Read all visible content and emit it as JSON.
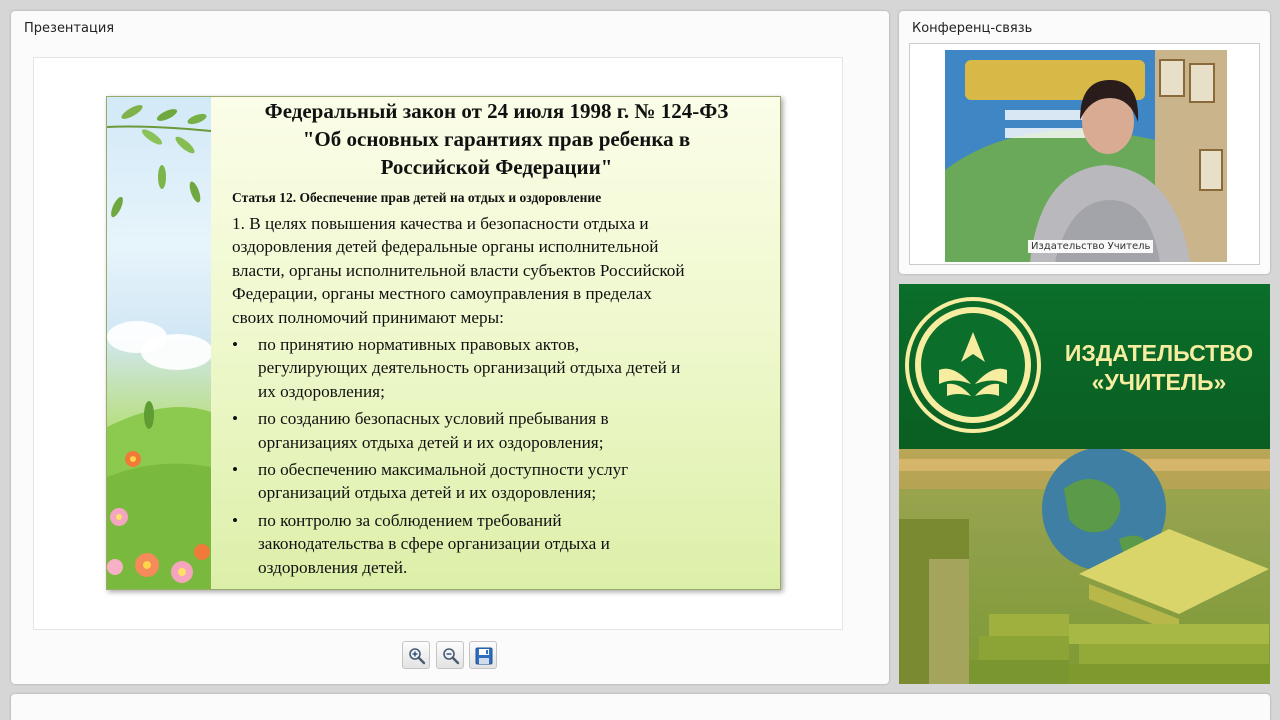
{
  "presentation_panel": {
    "title": "Презентация"
  },
  "slide": {
    "title_lines": [
      "Федеральный закон от 24 июля 1998 г. № 124-ФЗ",
      "\"Об основных гарантиях прав ребенка в",
      "Российской Федерации\""
    ],
    "article": "Статья 12. Обеспечение прав детей на отдых и оздоровление",
    "paragraph_lines": [
      "1. В целях повышения качества и безопасности отдыха и",
      "оздоровления детей федеральные органы исполнительной",
      "власти, органы исполнительной власти субъектов Российской",
      "Федерации, органы местного самоуправления в пределах",
      "своих полномочий принимают меры:"
    ],
    "bullet_symbol": "•",
    "bullets": [
      {
        "lines": [
          "по принятию нормативных правовых актов,",
          "регулирующих деятельность организаций отдыха детей и",
          "их оздоровления;"
        ]
      },
      {
        "lines": [
          "по созданию безопасных условий пребывания в",
          "организациях отдыха детей и их оздоровления;"
        ]
      },
      {
        "lines": [
          "по обеспечению максимальной доступности услуг",
          "организаций отдыха детей и их оздоровления;"
        ]
      },
      {
        "lines": [
          "по контролю за соблюдением требований",
          "законодательства в сфере организации отдыха и",
          "оздоровления детей."
        ]
      }
    ]
  },
  "toolbar": {
    "zoom_in_icon": "zoom-in-magnifier",
    "zoom_out_icon": "zoom-out-magnifier",
    "save_icon": "floppy-disk"
  },
  "conference_panel": {
    "title": "Конференц-связь",
    "participant_name": "Издательство Учитель"
  },
  "brand": {
    "name_line1": "ИЗДАТЕЛЬСТВО",
    "name_line2": "«УЧИТЕЛЬ»",
    "colors": {
      "green": "#0b6e2a",
      "text": "#f6eda1"
    }
  }
}
